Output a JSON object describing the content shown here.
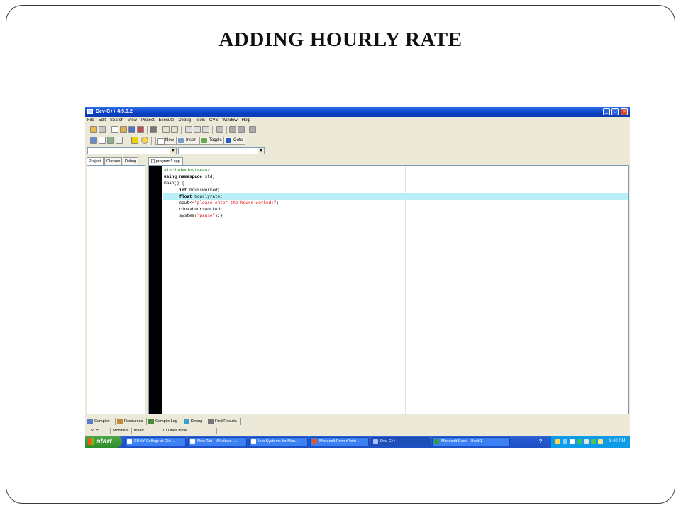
{
  "slide": {
    "title": "ADDING HOURLY RATE"
  },
  "window": {
    "title": "Dev-C++ 4.9.9.2"
  },
  "menu": [
    "File",
    "Edit",
    "Search",
    "View",
    "Project",
    "Execute",
    "Debug",
    "Tools",
    "CVS",
    "Window",
    "Help"
  ],
  "toolbar": {
    "new_label": "New",
    "insert_label": "Insert",
    "toggle_label": "Toggle",
    "goto_label": "Goto"
  },
  "left_tabs": [
    "Project",
    "Classes",
    "Debug"
  ],
  "file_tab": "[*] program1.cpp",
  "code": {
    "l1": "#include<iostream>",
    "l2_kw": "using namespace",
    "l2_rest": " std;",
    "l3": "main() {",
    "l4_indent": "      ",
    "l4_kw": "int",
    "l4_rest": " hoursworked;",
    "l5_indent": "      ",
    "l5_kw": "float",
    "l5_rest": " hourlyrate;",
    "l6_pre": "      cout<<",
    "l6_str": "\"please enter the hours worked:\"",
    "l6_post": ";",
    "l7": "      cin>>hoursworked;",
    "l8_pre": "      system(",
    "l8_str": "\"pause\"",
    "l8_post": ");}"
  },
  "bottom_tabs": [
    "Compiler",
    "Resources",
    "Compile Log",
    "Debug",
    "Find Results"
  ],
  "status": {
    "position": "5: 25",
    "state": "Modified",
    "mode": "Insert",
    "lines": "10 Lines in file"
  },
  "taskbar": {
    "start": "start",
    "tasks": [
      "SUNY College at Old ...",
      "New Tab - Windows I...",
      "Info Systems for Man...",
      "Microsoft PowerPoint ...",
      "Dev-C++",
      "Microsoft Excel - Book1"
    ],
    "help": "?",
    "clock": "8:40 PM"
  },
  "colors": {
    "accent": "#0a3fc4",
    "highlight_line": "#b9f0f7",
    "string": "#e00000",
    "preprocessor": "#008000"
  }
}
